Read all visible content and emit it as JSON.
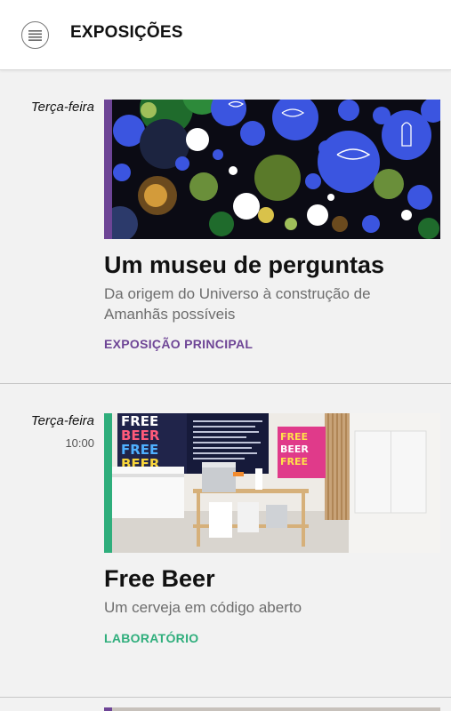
{
  "header": {
    "title": "EXPOSIÇÕES",
    "menu_icon": "hamburger-menu-icon"
  },
  "events": [
    {
      "day": "Terça-feira",
      "time": "",
      "title": "Um museu de perguntas",
      "subtitle": "Da origem do Universo à construção de Amanhãs possíveis",
      "category": "EXPOSIÇÃO PRINCIPAL",
      "accent": "#6e4596"
    },
    {
      "day": "Terça-feira",
      "time": "10:00",
      "title": "Free Beer",
      "subtitle": "Um cerveja em código aberto",
      "category": "LABORATÓRIO",
      "accent": "#2fae7c"
    }
  ],
  "colors": {
    "background": "#f2f2f2",
    "appbar": "#ffffff",
    "divider": "#c8c8c8",
    "subtitle": "#6d6d6d"
  }
}
